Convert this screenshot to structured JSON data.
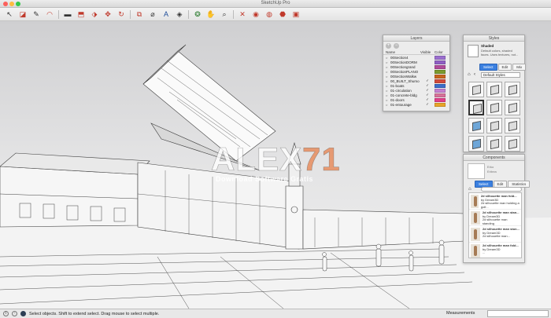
{
  "window": {
    "title": "SketchUp Pro"
  },
  "toolbar": {
    "tools": [
      {
        "icon": "select-arrow-icon",
        "glyph": "↖",
        "tone": ""
      },
      {
        "icon": "eraser-icon",
        "glyph": "◪",
        "tone": "red"
      },
      {
        "icon": "pencil-line-icon",
        "glyph": "✎",
        "tone": ""
      },
      {
        "icon": "arc-icon",
        "glyph": "◠",
        "tone": "red"
      },
      {
        "icon": "rectangle-icon",
        "glyph": "▬",
        "tone": ""
      },
      {
        "icon": "push-pull-icon",
        "glyph": "⬒",
        "tone": "red"
      },
      {
        "icon": "offset-icon",
        "glyph": "⬗",
        "tone": "red"
      },
      {
        "icon": "move-icon",
        "glyph": "✥",
        "tone": "red"
      },
      {
        "icon": "rotate-icon",
        "glyph": "↻",
        "tone": "red"
      },
      {
        "icon": "scale-icon",
        "glyph": "⧉",
        "tone": "red"
      },
      {
        "icon": "tape-measure-icon",
        "glyph": "⌀",
        "tone": ""
      },
      {
        "icon": "text-icon",
        "glyph": "A",
        "tone": "blue"
      },
      {
        "icon": "paint-bucket-icon",
        "glyph": "◈",
        "tone": ""
      },
      {
        "icon": "orbit-icon",
        "glyph": "❂",
        "tone": "green"
      },
      {
        "icon": "pan-hand-icon",
        "glyph": "✋",
        "tone": ""
      },
      {
        "icon": "zoom-icon",
        "glyph": "⌕",
        "tone": ""
      },
      {
        "icon": "zoom-extents-icon",
        "glyph": "✕",
        "tone": "red"
      },
      {
        "icon": "warehouse-icon",
        "glyph": "◉",
        "tone": "red"
      },
      {
        "icon": "share-model-icon",
        "glyph": "◍",
        "tone": "red"
      },
      {
        "icon": "extension-warehouse-icon",
        "glyph": "⬣",
        "tone": "red"
      },
      {
        "icon": "layout-icon",
        "glyph": "▣",
        "tone": "red"
      }
    ]
  },
  "watermark": {
    "brand": "ALEX",
    "number": "71",
    "tagline": "Download Software Gratis"
  },
  "layers_panel": {
    "title": "Layers",
    "columns": {
      "name": "Name",
      "visible": "Visible",
      "color": "Color"
    },
    "rows": [
      {
        "name": "00Section4",
        "visible": "",
        "color": "#9b6fcf"
      },
      {
        "name": "00SectionDORM",
        "visible": "",
        "color": "#8f5fc4"
      },
      {
        "name": "00Sectiongrand",
        "visible": "",
        "color": "#b04a9a"
      },
      {
        "name": "00SectionPLANO",
        "visible": "",
        "color": "#7b9a2e"
      },
      {
        "name": "00SectionWalkw",
        "visible": "",
        "color": "#c8641e"
      },
      {
        "name": "00_BUILT_Shumo",
        "visible": "✓",
        "color": "#d24a3a"
      },
      {
        "name": "01-boats",
        "visible": "✓",
        "color": "#3c6cc8"
      },
      {
        "name": "01-circulation",
        "visible": "✓",
        "color": "#c47fd0"
      },
      {
        "name": "01-concrete-bldg",
        "visible": "✓",
        "color": "#d6729a"
      },
      {
        "name": "01-doors",
        "visible": "✓",
        "color": "#e23f8a"
      },
      {
        "name": "01-entourage",
        "visible": "✓",
        "color": "#e8a42a"
      }
    ]
  },
  "styles_panel": {
    "title": "Styles",
    "style_name": "Shaded",
    "style_desc": "Default colors, shaded faces. Uses textures, not...",
    "tabs": [
      "Select",
      "Edit",
      "Mix"
    ],
    "collection": "Default Styles"
  },
  "components_panel": {
    "title": "Components",
    "preview_name": "Erko",
    "preview_label": "Eritrea",
    "tabs": [
      "Select",
      "Edit",
      "Statistics"
    ],
    "search_placeholder": "",
    "items": [
      {
        "title": "2d silhouette man fold...",
        "author": "by Dream3D",
        "desc": "2d silhouette man holding a golf..."
      },
      {
        "title": "2d silhouette man stan...",
        "author": "by Dream3D",
        "desc": "2d silhouette man standing"
      },
      {
        "title": "2d silhouette man ston...",
        "author": "by Dream3D",
        "desc": "2d silhouette man..."
      },
      {
        "title": "2d silhouette man fold...",
        "author": "by Dream3D",
        "desc": "..."
      }
    ]
  },
  "statusbar": {
    "hint": "Select objects. Shift to extend select. Drag mouse to select multiple.",
    "measurements_label": "Measurements",
    "measurements_value": ""
  }
}
